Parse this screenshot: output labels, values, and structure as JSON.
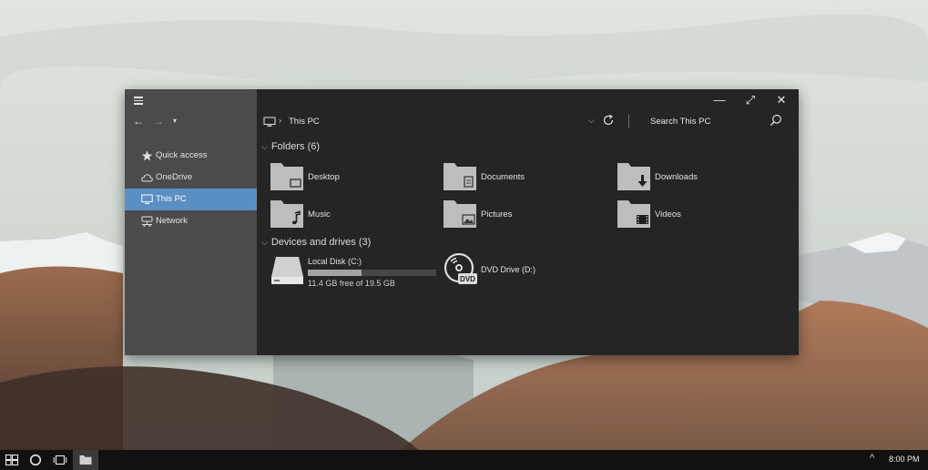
{
  "window": {
    "toolbar": {
      "back": "←",
      "forward": "→",
      "recent": "▾"
    },
    "titlebar": {
      "minimize": "—",
      "maximize": "⤢",
      "close": "✕"
    },
    "address": {
      "separator": "›",
      "location": "This PC",
      "dropdown": "⌵",
      "search_placeholder": "Search This PC"
    },
    "sidebar": {
      "items": [
        {
          "label": "Quick access",
          "icon": "star-icon"
        },
        {
          "label": "OneDrive",
          "icon": "cloud-icon"
        },
        {
          "label": "This PC",
          "icon": "monitor-icon",
          "active": true
        },
        {
          "label": "Network",
          "icon": "network-icon"
        }
      ]
    },
    "sections": {
      "folders_header": "Folders (6)",
      "drives_header": "Devices and drives (3)",
      "chevron": "⌵"
    },
    "folders": [
      {
        "label": "Desktop",
        "icon": "desktop-folder-icon"
      },
      {
        "label": "Documents",
        "icon": "documents-folder-icon"
      },
      {
        "label": "Downloads",
        "icon": "downloads-folder-icon"
      },
      {
        "label": "Music",
        "icon": "music-folder-icon"
      },
      {
        "label": "Pictures",
        "icon": "pictures-folder-icon"
      },
      {
        "label": "Videos",
        "icon": "videos-folder-icon"
      }
    ],
    "drives": [
      {
        "name": "Local Disk (C:)",
        "free": "11.4 GB free of 19.5 GB",
        "used_fraction": 0.415,
        "icon": "hard-drive-icon"
      },
      {
        "name": "DVD Drive (D:)",
        "icon": "dvd-drive-icon",
        "badge": "DVD"
      }
    ]
  },
  "taskbar": {
    "tray_chevron": "^",
    "time": "8:00 PM"
  },
  "colors": {
    "accent": "#5a8fc4",
    "window_bg": "#252525",
    "sidebar_bg": "#4b4b4b",
    "taskbar_bg": "#111111"
  }
}
